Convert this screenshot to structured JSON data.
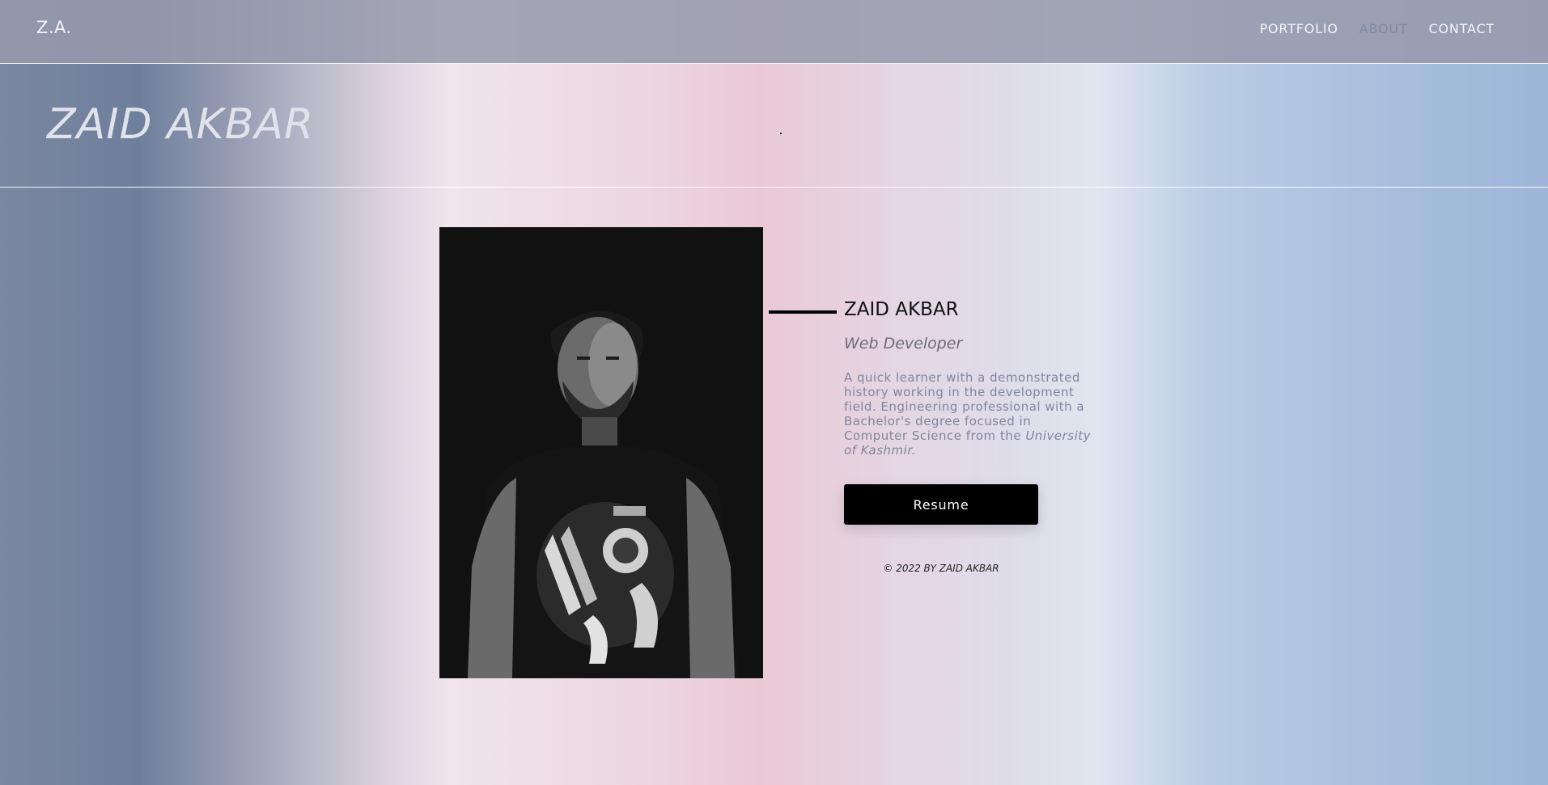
{
  "navbar": {
    "brand": "Z.A.",
    "links": [
      {
        "label": "PORTFOLIO"
      },
      {
        "label": "ABOUT"
      },
      {
        "label": "CONTACT"
      }
    ]
  },
  "header": {
    "title": "ZAID AKBAR"
  },
  "profile": {
    "name": "ZAID AKBAR",
    "role": "Web Developer",
    "bio": "A quick learner with a demonstrated history working in the development field. Engineering professional with a Bachelor's degree focused in Computer Science from the",
    "bio_university": "University of Kashmir.",
    "resume_label": "Resume",
    "copyright": "© 2022 BY ZAID AKBAR"
  },
  "colors": {
    "nav_active": "#7f8aa3",
    "button": "#000000"
  }
}
